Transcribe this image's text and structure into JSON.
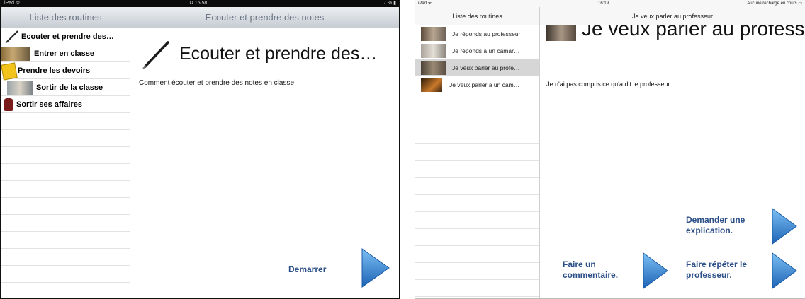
{
  "left": {
    "status": {
      "carrier": "iPad ᯤ",
      "time": "↻ 15:58",
      "battery": "7 % ▮"
    },
    "sidebar": {
      "title": "Liste des routines",
      "items": [
        {
          "label": "Ecouter et prendre des…"
        },
        {
          "label": "Entrer en classe"
        },
        {
          "label": "Prendre les devoirs"
        },
        {
          "label": "Sortir de la classe"
        },
        {
          "label": "Sortir ses affaires"
        }
      ]
    },
    "detail": {
      "nav_title": "Ecouter et prendre des notes",
      "heading": "Ecouter et prendre des…",
      "description": "Comment écouter et prendre des notes en classe",
      "start_label": "Demarrer"
    }
  },
  "right": {
    "status": {
      "carrier": "iPad ᯤ",
      "time": "16:19",
      "battery": "Aucune recharge en cours ▭"
    },
    "sidebar": {
      "title": "Liste des routines",
      "items": [
        {
          "label": "Je réponds au professeur"
        },
        {
          "label": "Je réponds à un camar…"
        },
        {
          "label": "Je veux parler au profe…"
        },
        {
          "label": "Je veux parler à un cam…"
        }
      ]
    },
    "detail": {
      "nav_title": "Je veux parler au professeur",
      "heading": "Je veux parler au profess…",
      "description": "Je n'ai pas compris ce qu'a dit le professeur.",
      "actions": {
        "explain": "Demander une explication.",
        "comment": "Faire un commentaire.",
        "repeat": "Faire répéter le professeur."
      }
    }
  },
  "colors": {
    "button_text": "#2c4f88",
    "arrow_light": "#6fb6f0",
    "arrow_dark": "#1f66b8",
    "selected_row": "#d6d6d6"
  }
}
